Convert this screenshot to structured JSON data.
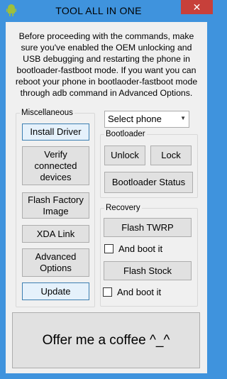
{
  "window": {
    "title": "TOOL ALL IN ONE",
    "close_glyph": "✕"
  },
  "intro": "Before proceeding with the commands, make sure you've enabled the OEM unlocking and USB debugging and restarting the phone in bootloader-fastboot mode. If you want you can reboot your phone in bootlaoder-fastboot mode through adb command in Advanced Options.",
  "miscellaneous": {
    "label": "Miscellaneous",
    "buttons": [
      "Install Driver",
      "Verify connected devices",
      "Flash Factory Image",
      "XDA Link",
      "Advanced Options",
      "Update"
    ]
  },
  "device_select": {
    "value": "Select phone"
  },
  "bootloader": {
    "label": "Bootloader",
    "unlock": "Unlock",
    "lock": "Lock",
    "status": "Bootloader Status"
  },
  "recovery": {
    "label": "Recovery",
    "flash_twrp": "Flash TWRP",
    "and_boot_1": "And boot it",
    "flash_stock": "Flash Stock",
    "and_boot_2": "And boot it"
  },
  "coffee": "Offer me a coffee  ^_^",
  "colors": {
    "titlebar": "#3f93dd",
    "close": "#c7403a",
    "android": "#9fbf3b"
  },
  "icons": {
    "app": "android-icon",
    "close": "close-icon",
    "dropdown": "chevron-down-icon"
  }
}
